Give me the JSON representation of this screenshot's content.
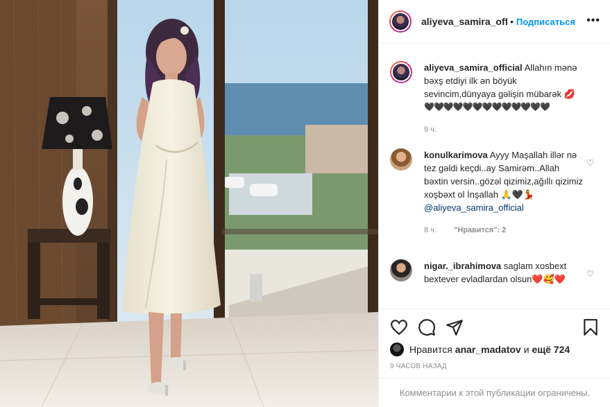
{
  "header": {
    "username": "aliyeva_samira_official",
    "separator": "•",
    "follow_label": "Подписаться",
    "more_label": "•••"
  },
  "caption": {
    "username": "aliyeva_samira_official",
    "text": "Allahın mənə bəxş etdiyi ilk ən böyük sevincim,dünyaya gəlişin mübarək 💋",
    "hearts": "🖤🖤🖤🖤🖤🖤🖤🖤🖤🖤🖤🖤🖤",
    "time": "9 ч."
  },
  "comments": [
    {
      "username": "konulkarimova",
      "text": "Ayyy Maşallah illər nə tez gəldi keçdi..ay Samirəm..Allah bəxtin versin..gözəl qizimiz,ağıllı qizimiz xoşbəxt ol İnşallah 🙏🖤💃",
      "mention": "@aliyeva_samira_official",
      "time": "8 ч.",
      "likes": "\"Нравится\": 2"
    },
    {
      "username": "nigar._ibrahimova",
      "text": "saglam xosbext bextever evladlardan olsun❤️🥰❤️",
      "time": "",
      "likes": ""
    }
  ],
  "likes_bar": {
    "prefix": "Нравится",
    "user": "anar_madatov",
    "suffix": "и",
    "count": "ещё 724"
  },
  "timeago": "9 ЧАСОВ НАЗАД",
  "comments_limited": "Комментарии к этой публикации ограничены."
}
